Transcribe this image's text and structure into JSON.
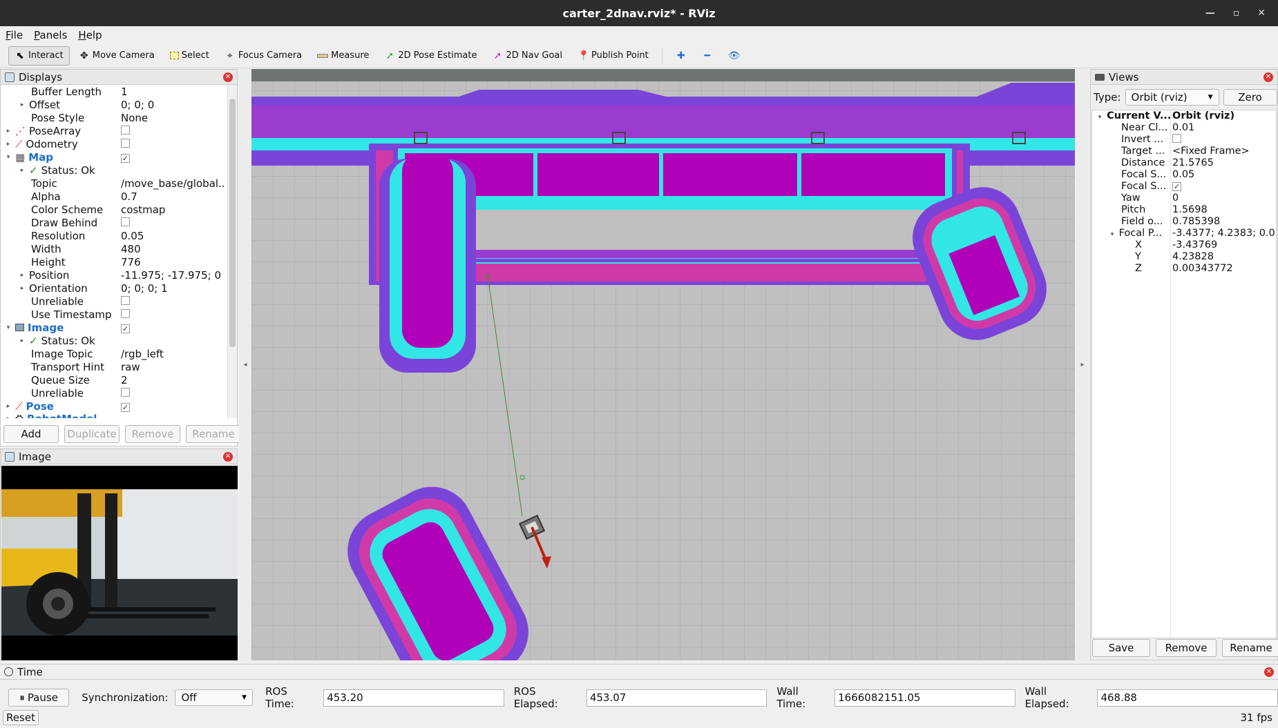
{
  "window": {
    "title": "carter_2dnav.rviz* - RViz"
  },
  "menu": [
    "File",
    "Panels",
    "Help"
  ],
  "toolbar": {
    "tools": [
      {
        "label": "Interact",
        "icon": "pointer-icon"
      },
      {
        "label": "Move Camera",
        "icon": "move-camera-icon"
      },
      {
        "label": "Select",
        "icon": "select-icon"
      },
      {
        "label": "Focus Camera",
        "icon": "focus-camera-icon"
      },
      {
        "label": "Measure",
        "icon": "ruler-icon"
      },
      {
        "label": "2D Pose Estimate",
        "icon": "green-arrow-icon"
      },
      {
        "label": "2D Nav Goal",
        "icon": "magenta-arrow-icon"
      },
      {
        "label": "Publish Point",
        "icon": "map-pin-icon"
      }
    ]
  },
  "displays": {
    "title": "Displays",
    "rows": [
      {
        "label": "Buffer Length",
        "value": "1"
      },
      {
        "label": "Offset",
        "value": "0; 0; 0"
      },
      {
        "label": "Pose Style",
        "value": "None"
      },
      {
        "label": "PoseArray",
        "value": ""
      },
      {
        "label": "Odometry",
        "value": ""
      },
      {
        "label": "Map",
        "value": ""
      },
      {
        "label": "Status: Ok",
        "value": ""
      },
      {
        "label": "Topic",
        "value": "/move_base/global..."
      },
      {
        "label": "Alpha",
        "value": "0.7"
      },
      {
        "label": "Color Scheme",
        "value": "costmap"
      },
      {
        "label": "Draw Behind",
        "value": ""
      },
      {
        "label": "Resolution",
        "value": "0.05"
      },
      {
        "label": "Width",
        "value": "480"
      },
      {
        "label": "Height",
        "value": "776"
      },
      {
        "label": "Position",
        "value": "-11.975; -17.975; 0"
      },
      {
        "label": "Orientation",
        "value": "0; 0; 0; 1"
      },
      {
        "label": "Unreliable",
        "value": ""
      },
      {
        "label": "Use Timestamp",
        "value": ""
      },
      {
        "label": "Image",
        "value": ""
      },
      {
        "label": "Status: Ok",
        "value": ""
      },
      {
        "label": "Image Topic",
        "value": "/rgb_left"
      },
      {
        "label": "Transport Hint",
        "value": "raw"
      },
      {
        "label": "Queue Size",
        "value": "2"
      },
      {
        "label": "Unreliable",
        "value": ""
      },
      {
        "label": "Pose",
        "value": ""
      },
      {
        "label": "RobotModel",
        "value": ""
      }
    ],
    "buttons": {
      "add": "Add",
      "duplicate": "Duplicate",
      "remove": "Remove",
      "rename": "Rename"
    }
  },
  "image_panel": {
    "title": "Image"
  },
  "views": {
    "title": "Views",
    "type_label": "Type:",
    "type_value": "Orbit (rviz)",
    "zero": "Zero",
    "rows": [
      {
        "label": "Current V...",
        "value": "Orbit (rviz)"
      },
      {
        "label": "Near Cl...",
        "value": "0.01"
      },
      {
        "label": "Invert ...",
        "value": ""
      },
      {
        "label": "Target ...",
        "value": "<Fixed Frame>"
      },
      {
        "label": "Distance",
        "value": "21.5765"
      },
      {
        "label": "Focal S...",
        "value": "0.05"
      },
      {
        "label": "Focal S...",
        "value": ""
      },
      {
        "label": "Yaw",
        "value": "0"
      },
      {
        "label": "Pitch",
        "value": "1.5698"
      },
      {
        "label": "Field o...",
        "value": "0.785398"
      },
      {
        "label": "Focal P...",
        "value": "-3.4377; 4.2383; 0.0..."
      },
      {
        "label": "X",
        "value": "-3.43769"
      },
      {
        "label": "Y",
        "value": "4.23828"
      },
      {
        "label": "Z",
        "value": "0.00343772"
      }
    ],
    "buttons": {
      "save": "Save",
      "remove": "Remove",
      "rename": "Rename"
    }
  },
  "time": {
    "title": "Time",
    "pause": "Pause",
    "sync_label": "Synchronization:",
    "sync_value": "Off",
    "ros_time_label": "ROS Time:",
    "ros_time": "453.20",
    "ros_elapsed_label": "ROS Elapsed:",
    "ros_elapsed": "453.07",
    "wall_time_label": "Wall Time:",
    "wall_time": "1666082151.05",
    "wall_elapsed_label": "Wall Elapsed:",
    "wall_elapsed": "468.88",
    "reset": "Reset",
    "fps": "31 fps"
  },
  "colors": {
    "costmap_lethal": "#b000b8",
    "costmap_inflated": "#33e6e6",
    "costmap_outer": "#7a44d8",
    "grid_bg": "#c0c0c0",
    "group_label": "#1d6fc4"
  }
}
